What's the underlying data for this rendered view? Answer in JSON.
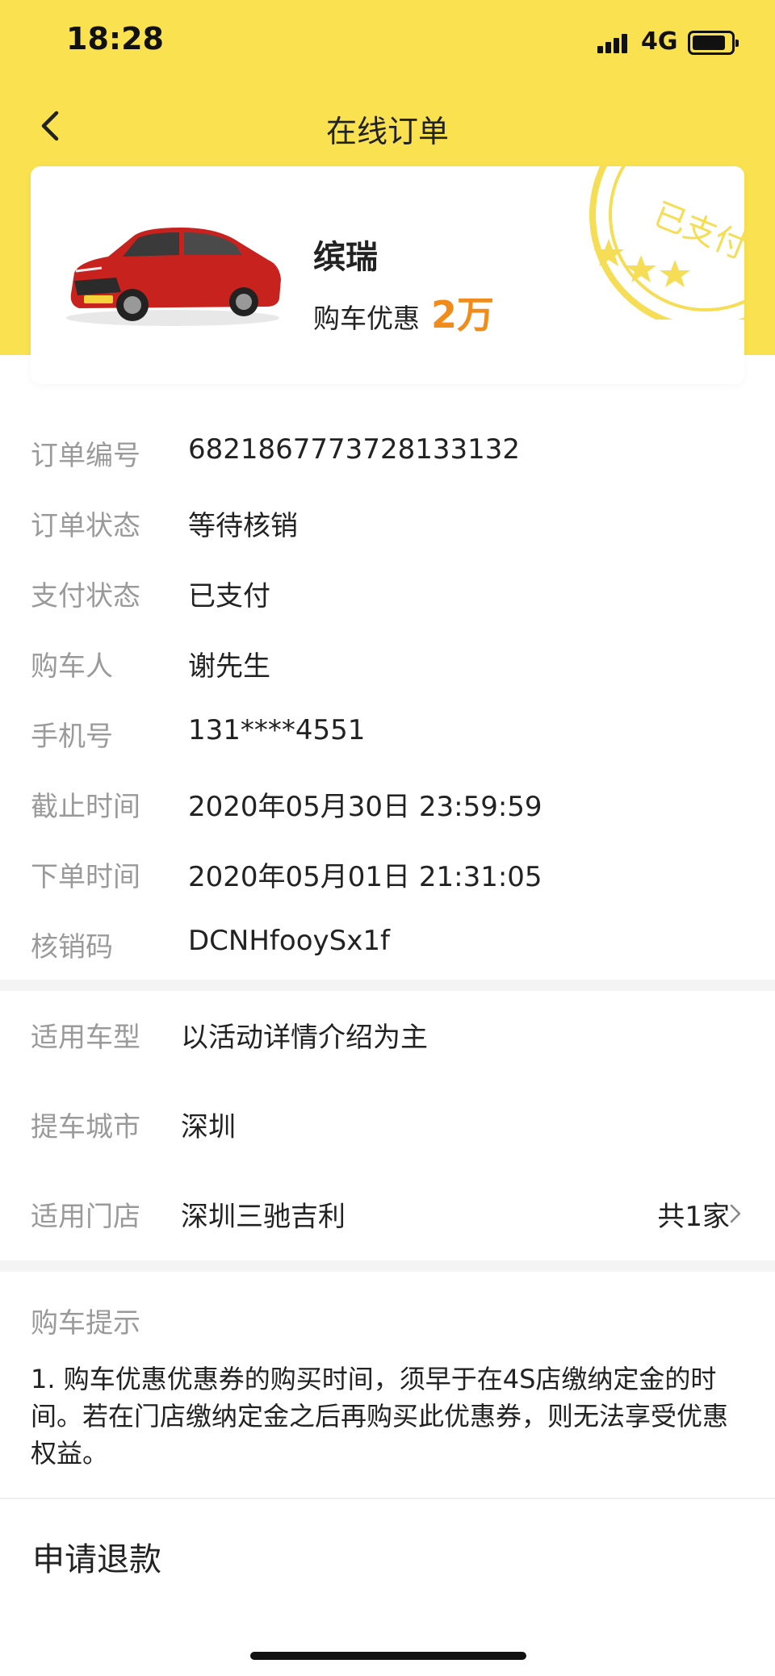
{
  "status_bar": {
    "time": "18:28",
    "network": "4G"
  },
  "header": {
    "title": "在线订单"
  },
  "product": {
    "name": "缤瑞",
    "promo_label": "购车优惠",
    "promo_amount": "2万",
    "paid_stamp": "已支付"
  },
  "order_details": [
    {
      "label": "订单编号",
      "value": "6821867773728133132"
    },
    {
      "label": "订单状态",
      "value": "等待核销"
    },
    {
      "label": "支付状态",
      "value": "已支付"
    },
    {
      "label": "购车人",
      "value": "谢先生"
    },
    {
      "label": "手机号",
      "value": "131****4551"
    },
    {
      "label": "截止时间",
      "value": "2020年05月30日 23:59:59"
    },
    {
      "label": "下单时间",
      "value": "2020年05月01日 21:31:05"
    },
    {
      "label": "核销码",
      "value": "DCNHfooySx1f"
    }
  ],
  "applicability": {
    "model_label": "适用车型",
    "model_value": "以活动详情介绍为主",
    "city_label": "提车城市",
    "city_value": "深圳",
    "store_label": "适用门店",
    "store_value": "深圳三驰吉利",
    "store_count": "共1家"
  },
  "tips": {
    "title": "购车提示",
    "text": "1. 购车优惠优惠券的购买时间，须早于在4S店缴纳定金的时间。若在门店缴纳定金之后再购买此优惠券，则无法享受优惠权益。"
  },
  "actions": {
    "refund": "申请退款"
  },
  "colors": {
    "brand_yellow": "#F9E14F",
    "accent_orange": "#F08C1C",
    "label_gray": "#9a9a9a"
  }
}
